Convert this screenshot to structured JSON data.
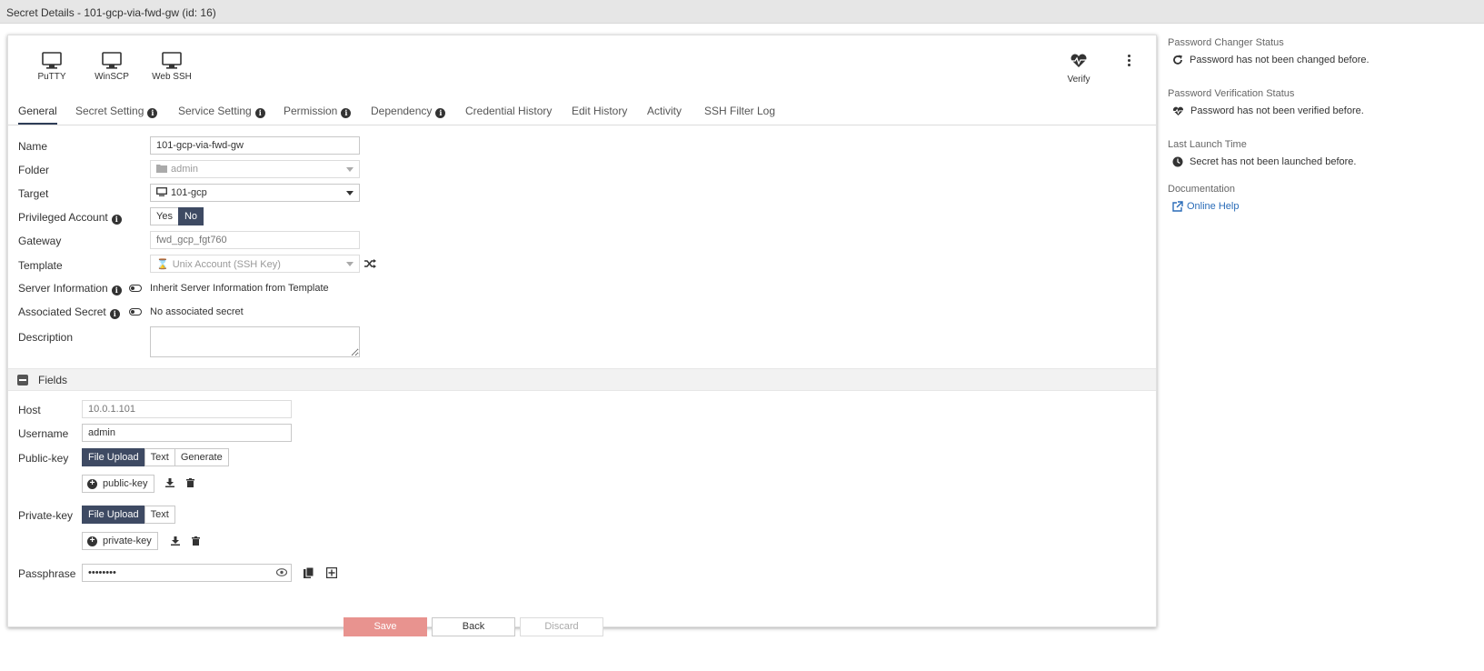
{
  "window": {
    "title": "Secret Details - 101-gcp-via-fwd-gw (id: 16)"
  },
  "launchers": [
    {
      "label": "PuTTY",
      "icon": "monitor-icon"
    },
    {
      "label": "WinSCP",
      "icon": "monitor-icon"
    },
    {
      "label": "Web SSH",
      "icon": "monitor-icon"
    }
  ],
  "toolbar": {
    "verify_label": "Verify"
  },
  "tabs": [
    {
      "label": "General"
    },
    {
      "label": "Secret Setting"
    },
    {
      "label": "Service Setting"
    },
    {
      "label": "Permission"
    },
    {
      "label": "Dependency"
    },
    {
      "label": "Credential History"
    },
    {
      "label": "Edit History"
    },
    {
      "label": "Activity"
    },
    {
      "label": "SSH Filter Log"
    }
  ],
  "general": {
    "name_label": "Name",
    "name_value": "101-gcp-via-fwd-gw",
    "folder_label": "Folder",
    "folder_value": "admin",
    "target_label": "Target",
    "target_value": "101-gcp",
    "privileged_label": "Privileged Account",
    "privileged_yes": "Yes",
    "privileged_no": "No",
    "gateway_label": "Gateway",
    "gateway_placeholder": "fwd_gcp_fgt760",
    "template_label": "Template",
    "template_value": "Unix Account (SSH Key)",
    "server_info_label": "Server Information",
    "server_info_text": "Inherit Server Information from Template",
    "assoc_label": "Associated Secret",
    "assoc_text": "No associated secret",
    "description_label": "Description"
  },
  "fields": {
    "header": "Fields",
    "host_label": "Host",
    "host_placeholder": "10.0.1.101",
    "username_label": "Username",
    "username_value": "admin",
    "pubkey_label": "Public-key",
    "pubkey_opts": [
      "File Upload",
      "Text",
      "Generate"
    ],
    "pubkey_file": "public-key",
    "privkey_label": "Private-key",
    "privkey_opts": [
      "File Upload",
      "Text"
    ],
    "privkey_file": "private-key",
    "passphrase_label": "Passphrase",
    "passphrase_value": "••••••••"
  },
  "sidebar": {
    "pw_changer_heading": "Password Changer Status",
    "pw_changer_value": "Password has not been changed before.",
    "pw_verify_heading": "Password Verification Status",
    "pw_verify_value": "Password has not been verified before.",
    "launch_heading": "Last Launch Time",
    "launch_value": "Secret has not been launched before.",
    "doc_heading": "Documentation",
    "doc_link": "Online Help"
  },
  "footer": {
    "save": "Save",
    "back": "Back",
    "discard": "Discard"
  },
  "colors": {
    "accent": "#3e4a63",
    "save": "#e8938f",
    "link": "#2a6cb8"
  }
}
